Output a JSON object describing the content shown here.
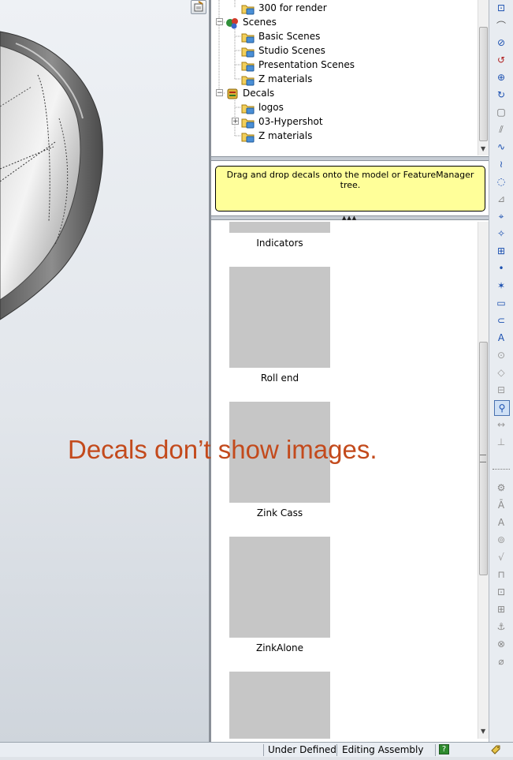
{
  "tree": {
    "items": [
      {
        "label": "300 for render",
        "icon": "folder-icon"
      },
      {
        "label": "Scenes",
        "icon": "scenes-icon"
      },
      {
        "label": "Basic Scenes",
        "icon": "folder-icon"
      },
      {
        "label": "Studio Scenes",
        "icon": "folder-icon"
      },
      {
        "label": "Presentation Scenes",
        "icon": "folder-icon"
      },
      {
        "label": "Z materials",
        "icon": "folder-icon"
      },
      {
        "label": "Decals",
        "icon": "decals-icon"
      },
      {
        "label": "logos",
        "icon": "folder-icon"
      },
      {
        "label": "03-Hypershot",
        "icon": "folder-icon"
      },
      {
        "label": "Z materials",
        "icon": "folder-icon"
      }
    ]
  },
  "info": {
    "text": "Drag and drop decals onto the model or FeatureManager tree."
  },
  "gallery": {
    "items": [
      {
        "label": "Indicators"
      },
      {
        "label": "Roll end"
      },
      {
        "label": "Zink Cass"
      },
      {
        "label": "ZinkAlone"
      },
      {
        "label": ""
      }
    ]
  },
  "status": {
    "state": "Under Defined",
    "mode": "Editing Assembly"
  },
  "overlay": {
    "text": "Decals don’t show images."
  },
  "colors": {
    "overlay_text": "#c34a1c",
    "info_bg": "#ffff99",
    "thumb_placeholder": "#c6c6c6"
  }
}
